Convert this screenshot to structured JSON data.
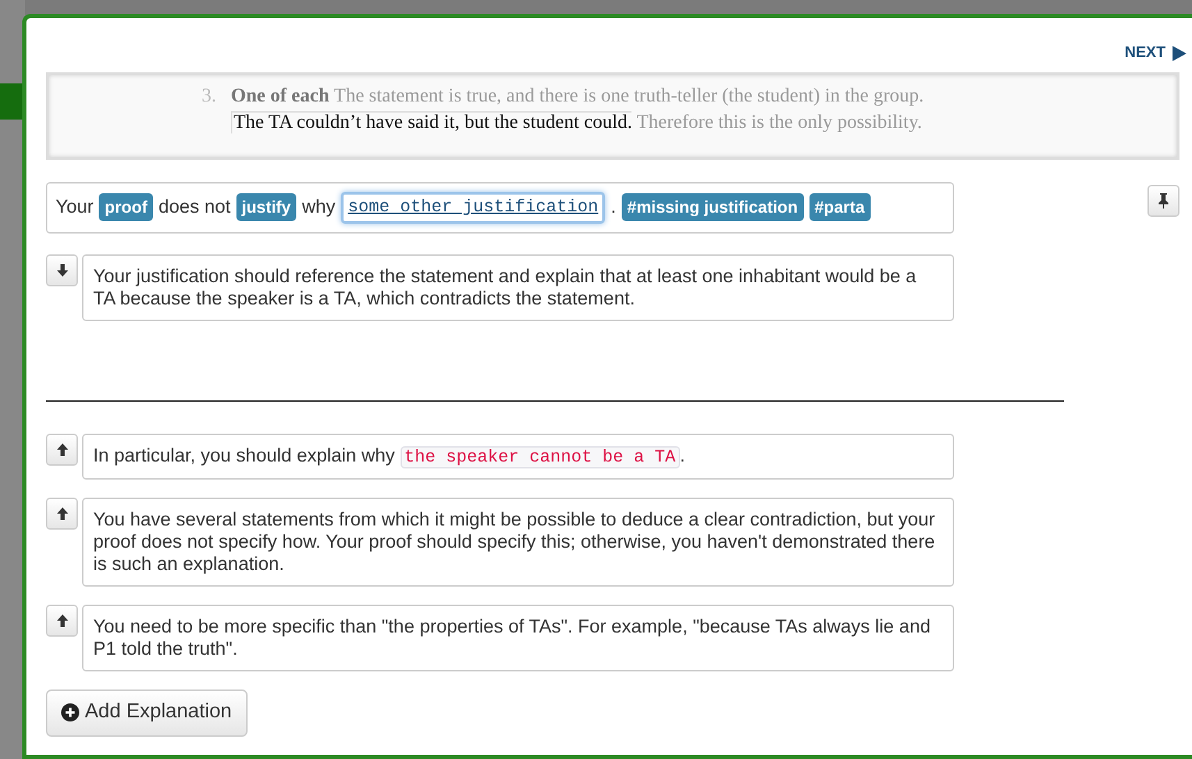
{
  "next": {
    "label": "NEXT"
  },
  "excerpt": {
    "number": "3.",
    "lines": [
      {
        "segments": [
          {
            "kind": "heading",
            "text": "One of each",
            "highlighted": false
          },
          {
            "kind": "sentence",
            "text": "The statement is true, and there is one truth-teller (the student) in the group.",
            "highlighted": false
          }
        ]
      },
      {
        "segments": [
          {
            "kind": "sentence",
            "text": "The TA couldn’t have said it, but the student could.",
            "highlighted": true
          },
          {
            "kind": "sentence",
            "text": "Therefore this is the only possibility.",
            "highlighted": false
          }
        ]
      }
    ]
  },
  "feedback": {
    "parts": [
      {
        "kind": "text",
        "text": "Your"
      },
      {
        "kind": "tag",
        "text": "proof"
      },
      {
        "kind": "text",
        "text": "does not"
      },
      {
        "kind": "tag",
        "text": "justify"
      },
      {
        "kind": "text",
        "text": "why"
      },
      {
        "kind": "field",
        "text": "some other justification"
      },
      {
        "kind": "text",
        "text": "."
      },
      {
        "kind": "tag",
        "text": "#missing justification"
      },
      {
        "kind": "tag",
        "text": "#parta"
      }
    ]
  },
  "explanation_groups": [
    {
      "explanations": [
        {
          "kind": "down",
          "parts": [
            {
              "kind": "text",
              "text": "Your justification should reference the statement and explain that at least one inhabitant would be a TA because the speaker is a TA, which contradicts the statement."
            }
          ]
        }
      ]
    },
    {
      "explanations": [
        {
          "kind": "up",
          "parts": [
            {
              "kind": "text",
              "text": "In particular, you should explain why"
            },
            {
              "kind": "code",
              "text": "the speaker cannot be a TA"
            },
            {
              "kind": "text",
              "text": "."
            }
          ]
        },
        {
          "kind": "up",
          "parts": [
            {
              "kind": "text",
              "text": "You have several statements from which it might be possible to deduce a clear contradiction, but your proof does not specify how. Your proof should specify this; otherwise, you haven't demonstrated there is such an explanation."
            }
          ]
        },
        {
          "kind": "up",
          "parts": [
            {
              "kind": "text",
              "text": "You need to be more specific than \"the properties of TAs\". For example, \"because TAs always lie and P1 told the truth\"."
            }
          ]
        }
      ]
    }
  ],
  "add_button": {
    "label": "Add Explanation"
  }
}
